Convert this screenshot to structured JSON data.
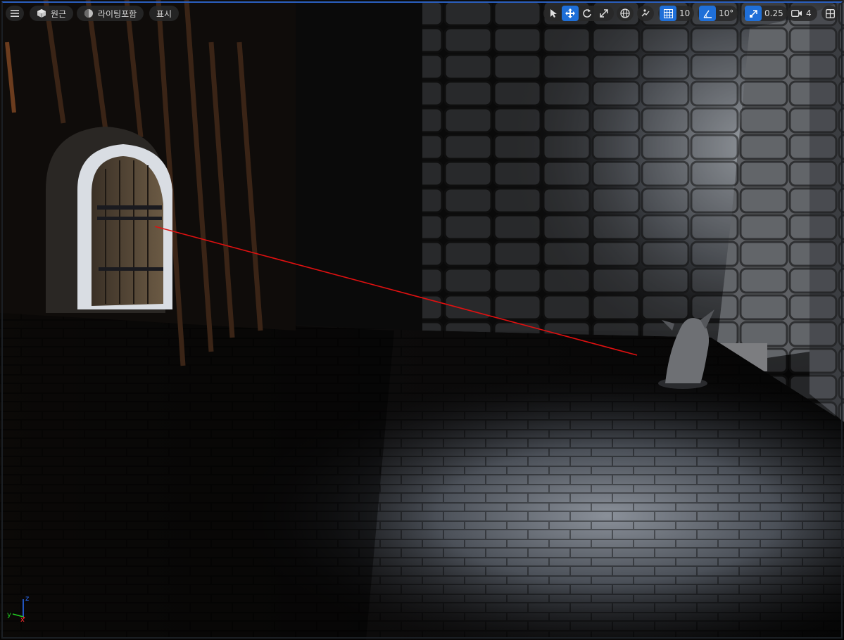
{
  "toolbar": {
    "perspective_label": "원근",
    "lighting_label": "라이팅포함",
    "show_label": "표시",
    "grid_snap_value": "10",
    "rotation_snap_value": "10°",
    "scale_snap_value": "0.25",
    "camera_speed_value": "4"
  },
  "axis": {
    "x": "x",
    "y": "y",
    "z": "z"
  },
  "colors": {
    "accent": "#1f6fd8",
    "trace_line": "#e01010",
    "toolbar_bg": "#282828"
  }
}
